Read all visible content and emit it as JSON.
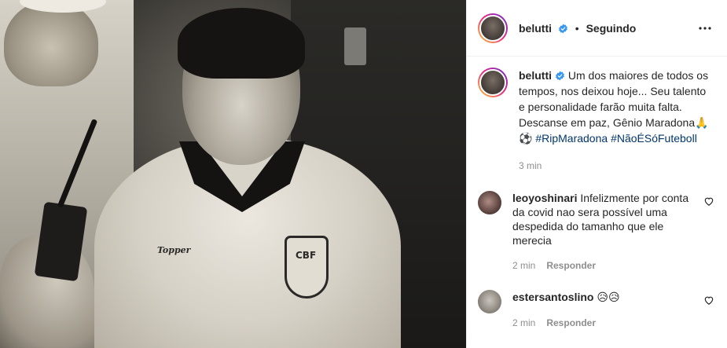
{
  "post": {
    "author": "belutti",
    "following_label": "Seguindo",
    "separator": "•"
  },
  "caption": {
    "author": "belutti",
    "text": "Um dos maiores de todos os tempos, nos deixou hoje... Seu talento e personalidade farão muita falta. Descanse em paz, Gênio Maradona🙏",
    "emoji_ball": "⚽",
    "hashtags": [
      "#RipMaradona",
      "#NãoÉSóFuteboll"
    ],
    "time": "3 min"
  },
  "comments": [
    {
      "user": "leoyoshinari",
      "text": "Infelizmente por conta da covid nao sera possível uma despedida do tamanho que ele merecia",
      "time": "2 min",
      "reply_label": "Responder"
    },
    {
      "user": "estersantoslino",
      "text": "😥😥",
      "time": "2 min",
      "reply_label": "Responder"
    }
  ],
  "photo": {
    "crest_text": "CBF",
    "brand_text": "Topper"
  },
  "colors": {
    "verified": "#3897f0",
    "hashtag": "#00376b",
    "muted": "#8e8e8e"
  },
  "icons": {
    "more": "more-options-icon",
    "verified": "verified-badge-icon",
    "like": "heart-icon"
  }
}
